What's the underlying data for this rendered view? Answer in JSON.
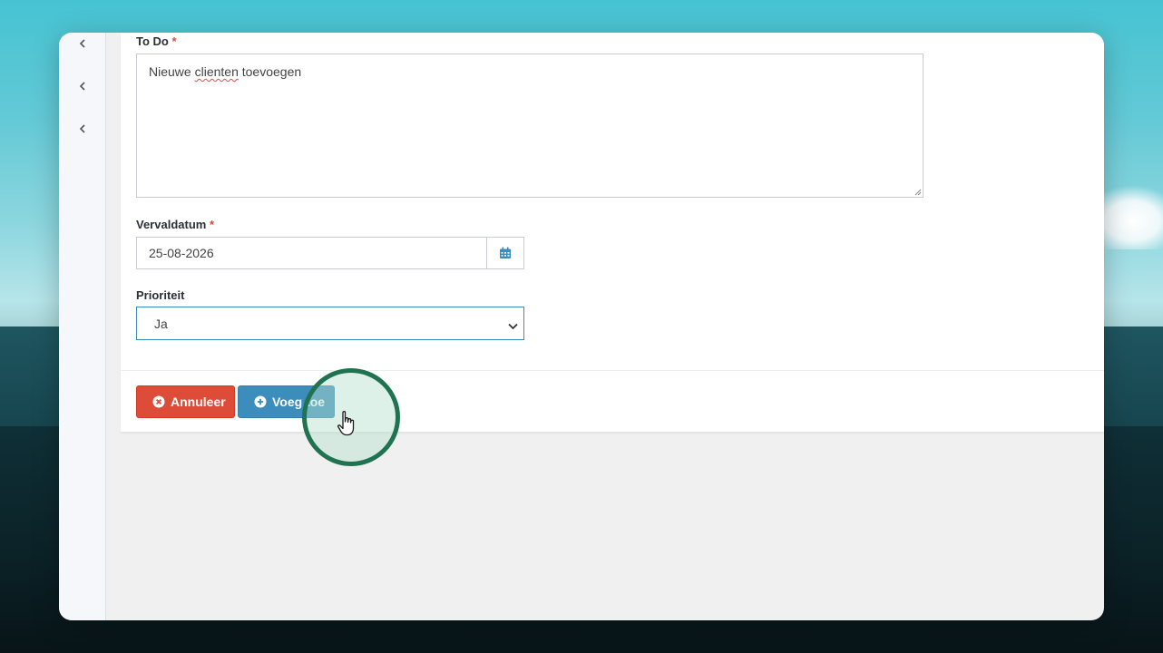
{
  "sidebar": {
    "collapse_icons": [
      "chevron-left-icon",
      "chevron-left-icon",
      "chevron-left-icon"
    ]
  },
  "form": {
    "todo": {
      "label": "To Do",
      "required_mark": "*",
      "value_prefix": "Nieuwe ",
      "value_misspelled": "clienten",
      "value_suffix": " toevoegen"
    },
    "due_date": {
      "label": "Vervaldatum",
      "required_mark": "*",
      "value": "25-08-2026",
      "icon": "calendar-icon"
    },
    "priority": {
      "label": "Prioriteit",
      "selected": "Ja",
      "icon": "chevron-down-icon"
    }
  },
  "actions": {
    "cancel_label": "Annuleer",
    "cancel_icon": "times-circle-icon",
    "add_label": "Voeg toe",
    "add_icon": "plus-circle-icon"
  },
  "colors": {
    "danger": "#dd4b39",
    "primary": "#3c8dbc",
    "highlight_ring": "#1f7350"
  }
}
